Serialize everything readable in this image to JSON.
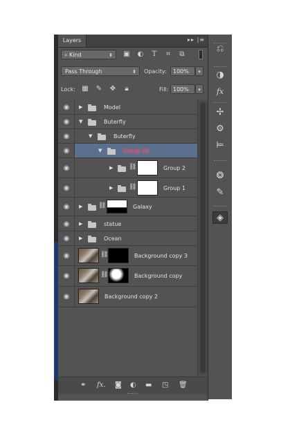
{
  "panel": {
    "tab_label": "Layers",
    "tab_controls": "▸▸",
    "menu_icon": "panel-menu-icon"
  },
  "filter": {
    "kind_label": "Kind",
    "filter_icons": [
      "image-filter-icon",
      "adjustment-filter-icon",
      "type-filter-icon",
      "shape-filter-icon",
      "smart-object-filter-icon"
    ]
  },
  "blend": {
    "mode": "Pass Through",
    "opacity_label": "Opacity:",
    "opacity_value": "100%"
  },
  "lock": {
    "label": "Lock:",
    "fill_label": "Fill:",
    "fill_value": "100%"
  },
  "layers": [
    {
      "name": "Model",
      "type": "group",
      "expanded": false,
      "indent": 0
    },
    {
      "name": "Buterfly",
      "type": "group",
      "expanded": true,
      "indent": 0
    },
    {
      "name": "Buterfly",
      "type": "group",
      "expanded": true,
      "indent": 1
    },
    {
      "name": "Group 14",
      "type": "group",
      "expanded": true,
      "indent": 2,
      "selected": true,
      "renaming": true
    },
    {
      "name": "Group 2",
      "type": "group-with-mask",
      "expanded": false,
      "indent": 3
    },
    {
      "name": "Group 1",
      "type": "group-with-mask",
      "expanded": false,
      "indent": 3
    },
    {
      "name": "Galaxy",
      "type": "group-with-mask",
      "expanded": false,
      "indent": 0
    },
    {
      "name": "statue",
      "type": "group",
      "expanded": false,
      "indent": 0
    },
    {
      "name": "Ocean",
      "type": "group",
      "expanded": false,
      "indent": 0
    },
    {
      "name": "Background copy 3",
      "type": "layer-with-mask",
      "indent": 0
    },
    {
      "name": "Background copy",
      "type": "layer-with-mask",
      "indent": 0
    },
    {
      "name": "Background copy 2",
      "type": "layer",
      "indent": 0
    }
  ],
  "colors": {
    "panel_bg": "#535353",
    "selected_row": "#5b6f8f",
    "rename_text": "#ff4a4a"
  },
  "bottom_icons": [
    "link-layers-icon",
    "fx-icon",
    "add-mask-icon",
    "adjustment-layer-icon",
    "new-group-icon",
    "new-layer-icon",
    "trash-icon"
  ],
  "bottom_labels": {
    "fx": "fx."
  },
  "right_icons": [
    "history-icon",
    "adjustments-icon",
    "styles-icon",
    "brush-presets-icon",
    "properties-icon",
    "align-icon",
    "channels-icon",
    "paths-icon",
    "layers-panel-icon"
  ]
}
